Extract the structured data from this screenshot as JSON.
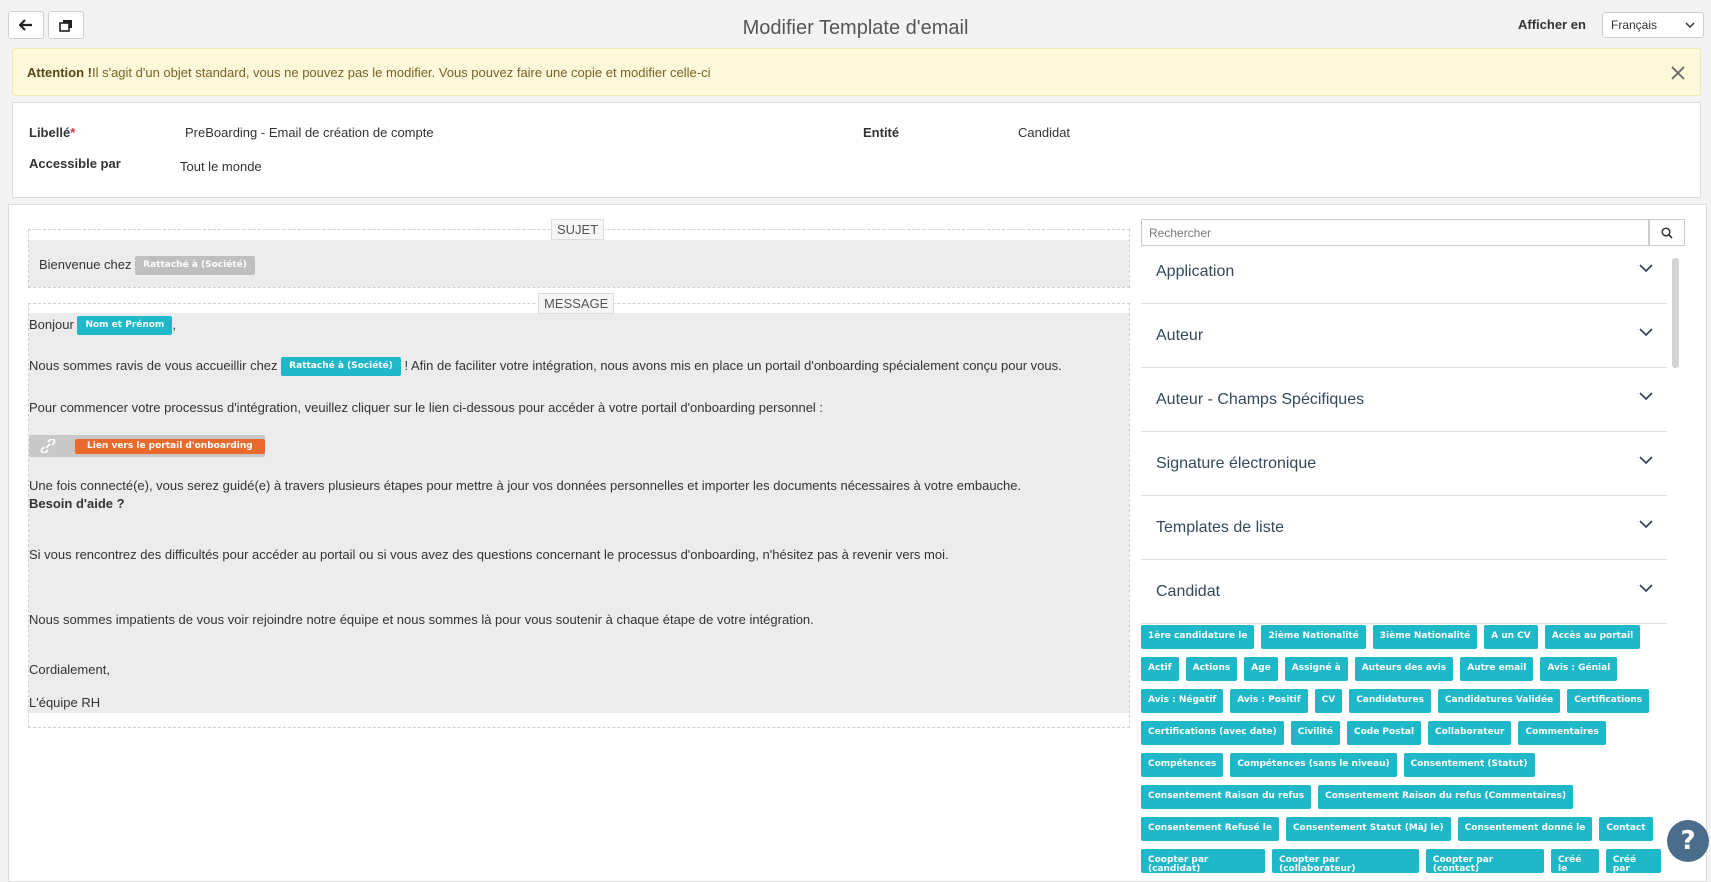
{
  "header": {
    "title": "Modifier Template d'email",
    "lang_label": "Afficher en",
    "lang_value": "Français"
  },
  "warning": {
    "bold": "Attention !",
    "text": "Il s'agit d'un objet standard, vous ne pouvez pas le modifier. Vous pouvez faire une copie et modifier celle-ci"
  },
  "fields": {
    "libelle_label": "Libellé",
    "libelle_value": "PreBoarding - Email de création de compte",
    "entite_label": "Entité",
    "entite_value": "Candidat",
    "accessible_label": "Accessible par",
    "accessible_value": "Tout le monde"
  },
  "editor": {
    "sujet_tag": "SUJET",
    "sujet_text": "Bienvenue chez",
    "sujet_chip": "Rattaché à (Société)",
    "message_tag": "MESSAGE",
    "line1_a": "Bonjour",
    "line1_chip": "Nom et Prénom",
    "line1_b": ",",
    "line2_a": "Nous sommes ravis de vous accueillir chez",
    "line2_chip": "Rattaché à (Société)",
    "line2_b": "! Afin de faciliter votre intégration, nous avons mis en place un portail d'onboarding spécialement conçu pour vous.",
    "line3": "Pour commencer votre processus d'intégration, veuillez cliquer sur le lien ci-dessous pour accéder à votre portail d'onboarding personnel :",
    "link_chip": "Lien vers le portail d'onboarding",
    "line4": "Une fois connecté(e), vous serez guidé(e) à travers plusieurs étapes pour mettre à jour vos données personnelles et importer les documents nécessaires à votre embauche.",
    "line5": "Besoin d'aide ?",
    "line6": "Si vous rencontrez des difficultés pour accéder au portail ou si vous avez des questions concernant le processus d'onboarding, n'hésitez pas à revenir vers moi.",
    "line7": "Nous sommes impatients de vous voir rejoindre notre équipe et nous sommes là pour vous soutenir à chaque étape de votre intégration.",
    "line8": "Cordialement,",
    "line9": "L'équipe RH"
  },
  "sidebar": {
    "search_placeholder": "Rechercher",
    "sections": [
      "Application",
      "Auteur",
      "Auteur - Champs Spécifiques",
      "Signature électronique",
      "Templates de liste",
      "Candidat"
    ],
    "chip_rows": [
      [
        "1ère candidature le",
        "2ième Nationalité",
        "3ième Nationalité",
        "A un CV",
        "Accès au portail"
      ],
      [
        "Actif",
        "Actions",
        "Age",
        "Assigné à",
        "Auteurs des avis",
        "Autre email",
        "Avis : Génial"
      ],
      [
        "Avis : Négatif",
        "Avis : Positif",
        "CV",
        "Candidatures",
        "Candidatures Validée",
        "Certifications"
      ],
      [
        "Certifications (avec date)",
        "Civilité",
        "Code Postal",
        "Collaborateur",
        "Commentaires"
      ],
      [
        "Compétences",
        "Compétences (sans le niveau)",
        "Consentement (Statut)"
      ],
      [
        "Consentement Raison du refus",
        "Consentement Raison du refus (Commentaires)"
      ],
      [
        "Consentement Refusé le",
        "Consentement Statut (MàJ le)",
        "Consentement donné le",
        "Contact"
      ],
      [
        "Coopter par (candidat)",
        "Coopter par (collaborateur)",
        "Coopter par (contact)",
        "Créé le",
        "Créé par"
      ]
    ]
  },
  "help": {
    "label": "?"
  },
  "colors": {
    "chip_teal": "#1fb8c8",
    "chip_orange": "#ea6a2d",
    "warning_bg": "#fcf8d9",
    "help_bg": "#4a6d8c"
  }
}
